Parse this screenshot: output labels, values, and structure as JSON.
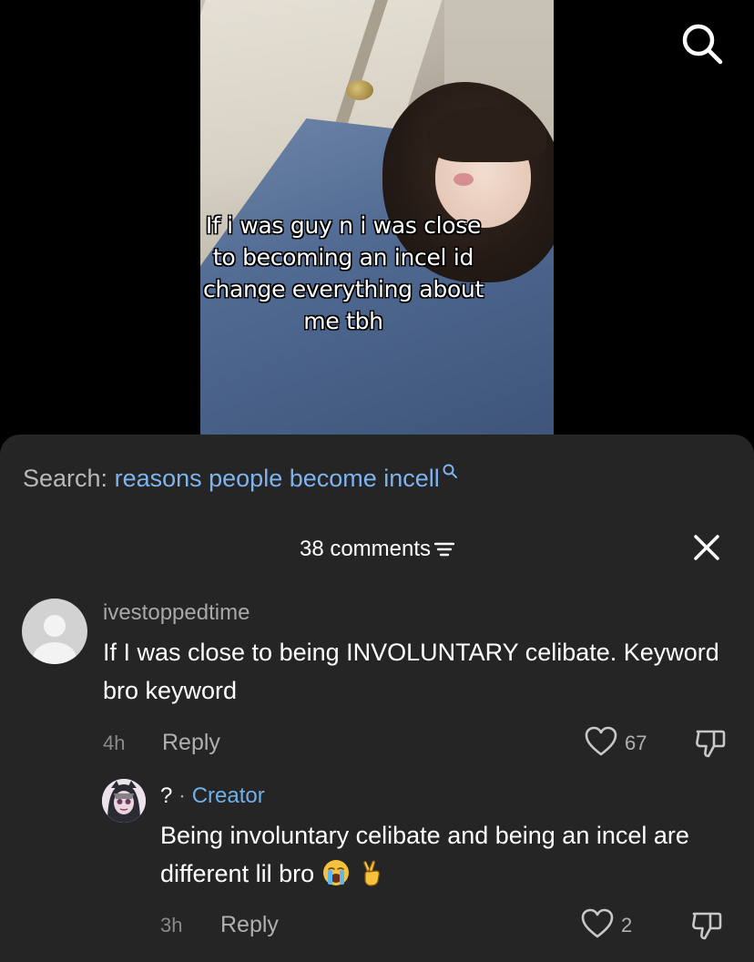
{
  "video": {
    "caption": "If i was guy n i was close to becoming an incel id change everything about me tbh"
  },
  "search_bar": {
    "prefix": "Search:",
    "term": "reasons people become incell"
  },
  "comments_panel": {
    "count_label": "38 comments"
  },
  "comments": [
    {
      "username": "ivestoppedtime",
      "text": "If I was close to being INVOLUNTARY celibate. Keyword bro keyword",
      "time": "4h",
      "reply_label": "Reply",
      "likes": "67"
    }
  ],
  "replies": [
    {
      "username": "?",
      "separator": "·",
      "badge": "Creator",
      "text": "Being involuntary celibate and being an incel are different lil bro",
      "emojis": [
        "loudly-crying-face",
        "victory-hand"
      ],
      "time": "3h",
      "reply_label": "Reply",
      "likes": "2"
    }
  ],
  "colors": {
    "sheet_bg": "#252525",
    "accent_link": "#7db3ef",
    "creator_badge": "#6fb0e8"
  }
}
